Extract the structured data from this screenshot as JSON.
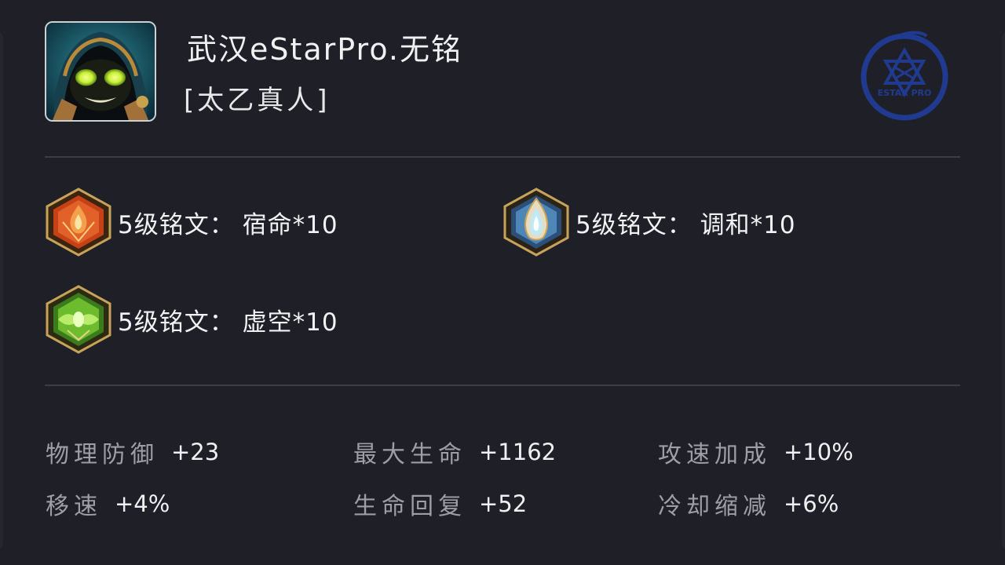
{
  "player": {
    "name": "武汉eStarPro.无铭",
    "hero": "[太乙真人]",
    "avatar_icon": "taiyi-zhenren-portrait"
  },
  "team_logo": {
    "icon": "estar-pro-logo",
    "text": "ESTAR PRO",
    "color": "#1f3a8f"
  },
  "runes": [
    {
      "level_label": "5级铭文：",
      "name": "宿命*10",
      "color": "red",
      "icon": "red-rune-icon"
    },
    {
      "level_label": "5级铭文：",
      "name": "调和*10",
      "color": "blue",
      "icon": "blue-rune-icon"
    },
    {
      "level_label": "5级铭文：",
      "name": "虚空*10",
      "color": "green",
      "icon": "green-rune-icon"
    }
  ],
  "stats": [
    {
      "label": "物理防御",
      "value": "+23"
    },
    {
      "label": "最大生命",
      "value": "+1162"
    },
    {
      "label": "攻速加成",
      "value": "+10%"
    },
    {
      "label": "移速",
      "value": "+4%"
    },
    {
      "label": "生命回复",
      "value": "+52"
    },
    {
      "label": "冷却缩减",
      "value": "+6%"
    }
  ],
  "colors": {
    "background": "#1f2027",
    "divider": "#3b3c46",
    "text_primary": "#f2f2f4",
    "text_secondary": "#9d9ea6"
  }
}
